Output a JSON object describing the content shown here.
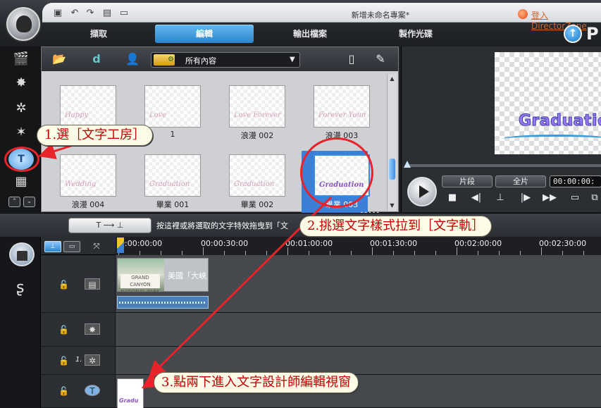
{
  "window": {
    "title": "新增未命名專案*",
    "login_link": "登入 DirectorZone",
    "app_letter": "P"
  },
  "tabs": [
    {
      "label": "擷取",
      "active": false
    },
    {
      "label": "編輯",
      "active": true
    },
    {
      "label": "輸出檔案",
      "active": false
    },
    {
      "label": "製作光碟",
      "active": false
    }
  ],
  "library": {
    "filter": "所有內容",
    "items": [
      {
        "label": "",
        "deco": "Happy"
      },
      {
        "label": "1",
        "deco": "Love"
      },
      {
        "label": "浪漫 002",
        "deco": "Love Forever"
      },
      {
        "label": "浪漫 003",
        "deco": "Forever Young"
      },
      {
        "label": "浪漫 004",
        "deco": "Wedding"
      },
      {
        "label": "畢業 001",
        "deco": "Graduation"
      },
      {
        "label": "畢業 002",
        "deco": "Graduation"
      },
      {
        "label": "畢業 003",
        "deco": "Graduation"
      }
    ]
  },
  "preview": {
    "text": "Graduatio",
    "mode_clip": "片段",
    "mode_movie": "全片",
    "timecode": "00:00:00:"
  },
  "timeline": {
    "hint": "按這裡或將選取的文字特效拖曳到「文",
    "ruler": [
      "0:00:00:00",
      "00:00:30:00",
      "00:01:00:00",
      "00:01:30:00",
      "00:02:00:00",
      "00:02:30:00"
    ],
    "video_clip_label": "美國「大峽",
    "video_frame_sign": "GRAND CANYON NATIONAL PARK",
    "title_clip_text": "Gradu",
    "effect_track_num": "1."
  },
  "annotations": {
    "step1": "1.選［文字工房］",
    "step2": "2.挑選文字樣式拉到［文字軌］",
    "step3": "3.點兩下進入文字設計師編輯視窗",
    "color": "#e8232a"
  },
  "colors": {
    "accent": "#3b8be0",
    "highlight": "#e8232a"
  }
}
